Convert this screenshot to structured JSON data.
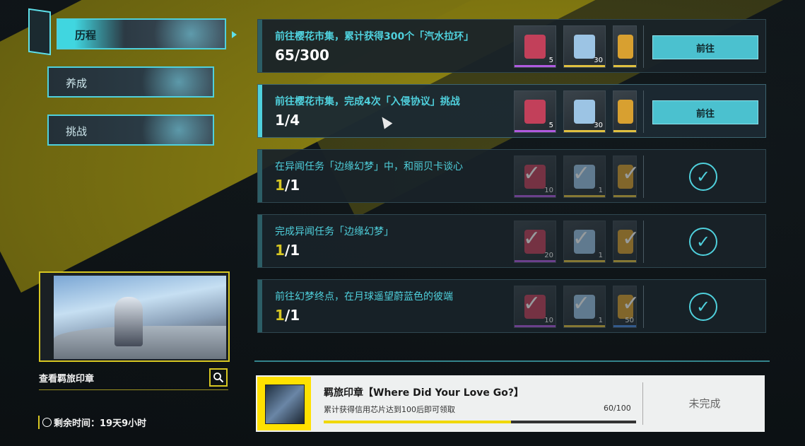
{
  "sidebar": {
    "tabs": [
      {
        "label": "历程",
        "active": true
      },
      {
        "label": "养成",
        "active": false
      },
      {
        "label": "挑战",
        "active": false
      }
    ]
  },
  "stamp_panel": {
    "title": "查看羁旅印章",
    "search_icon": "search-icon",
    "remaining_time": "剩余时间：19天9小时"
  },
  "tasks": [
    {
      "desc": "前往樱花市集，累计获得300个「汽水拉环」",
      "progress_current": "65",
      "progress_total": "/300",
      "rewards": [
        {
          "count": "5",
          "color": "#b05ae0"
        },
        {
          "count": "30",
          "color": "#e0c040"
        },
        {
          "count": "",
          "color": "#e0c040"
        }
      ],
      "action": "前往",
      "done": false
    },
    {
      "desc": "前往樱花市集，完成4次「入侵协议」挑战",
      "progress_current": "1",
      "progress_total": "/4",
      "rewards": [
        {
          "count": "5",
          "color": "#b05ae0"
        },
        {
          "count": "30",
          "color": "#e0c040"
        },
        {
          "count": "",
          "color": "#e0c040"
        }
      ],
      "action": "前往",
      "done": false
    },
    {
      "desc": "在异闻任务「边缘幻梦」中，和丽贝卡谈心",
      "progress_current": "1",
      "progress_total": "/1",
      "rewards": [
        {
          "count": "10",
          "color": "#b05ae0"
        },
        {
          "count": "1",
          "color": "#e0c040"
        },
        {
          "count": "",
          "color": "#e0c040"
        }
      ],
      "action": "",
      "done": true
    },
    {
      "desc": "完成异闻任务「边缘幻梦」",
      "progress_current": "1",
      "progress_total": "/1",
      "rewards": [
        {
          "count": "20",
          "color": "#b05ae0"
        },
        {
          "count": "1",
          "color": "#e0c040"
        },
        {
          "count": "",
          "color": "#e0c040"
        }
      ],
      "action": "",
      "done": true
    },
    {
      "desc": "前往幻梦终点，在月球遥望蔚蓝色的彼端",
      "progress_current": "1",
      "progress_total": "/1",
      "rewards": [
        {
          "count": "10",
          "color": "#b05ae0"
        },
        {
          "count": "1",
          "color": "#e0c040"
        },
        {
          "count": "50",
          "color": "#4a8ae0"
        }
      ],
      "action": "",
      "done": true
    }
  ],
  "bottom_card": {
    "title": "羁旅印章【Where Did Your Love Go?】",
    "subtitle": "累计获得信用芯片达到100后即可领取",
    "progress_text": "60/100",
    "progress_fraction": 0.6,
    "status": "未完成"
  }
}
